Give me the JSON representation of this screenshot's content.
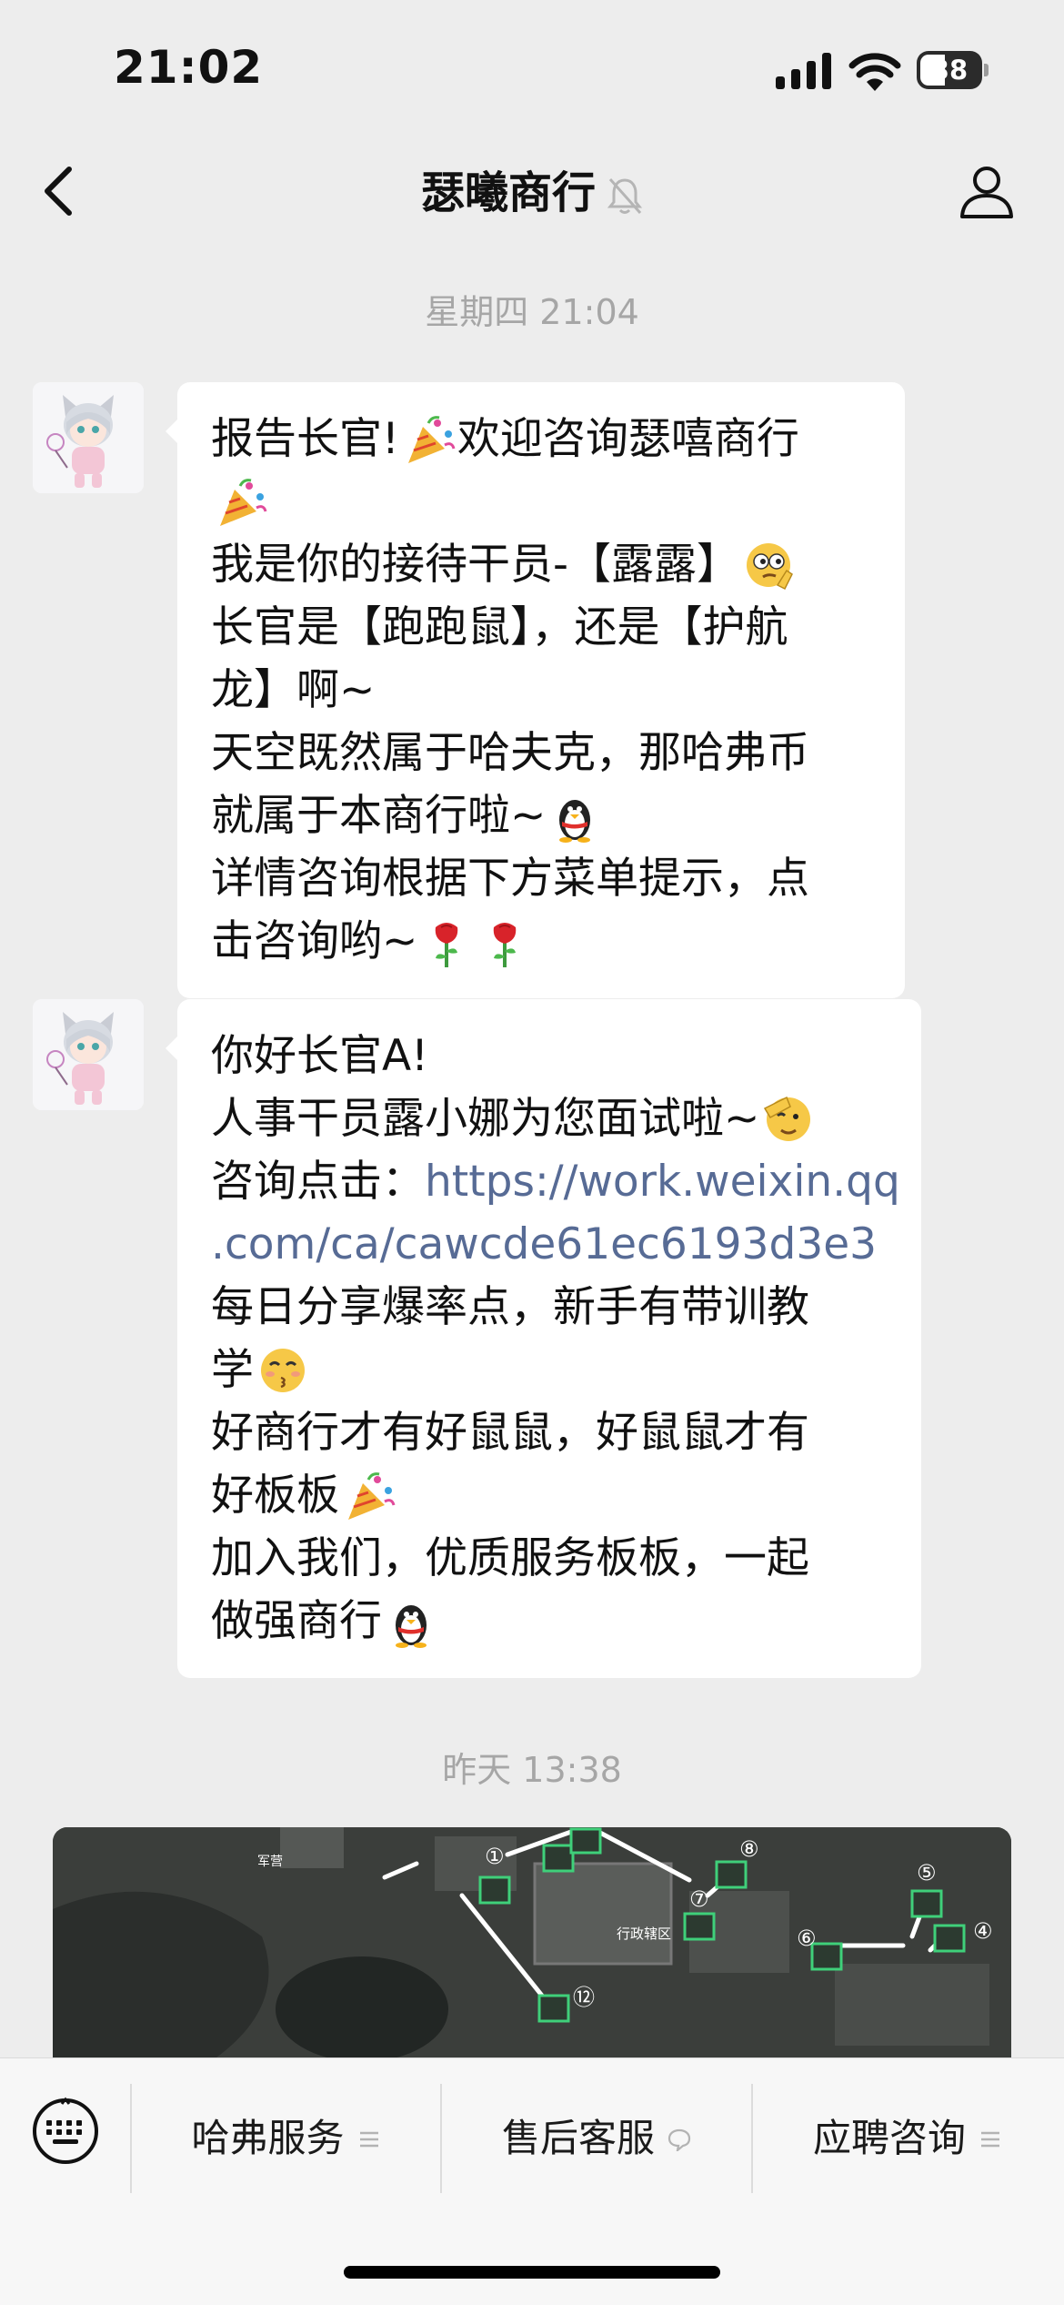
{
  "status_bar": {
    "time": "21:02",
    "battery_level": "38"
  },
  "header": {
    "title": "瑟曦商行"
  },
  "messages": [
    {
      "timestamp": "星期四 21:04",
      "lines": [
        {
          "parts": [
            {
              "text": "报告长官!"
            },
            {
              "icon": "party-popper-emoji"
            },
            {
              "text": "欢迎咨询瑟嘻商行"
            }
          ]
        },
        {
          "parts": [
            {
              "icon": "party-popper-emoji"
            }
          ]
        },
        {
          "parts": [
            {
              "text": "我是你的接待干员-【露露】"
            },
            {
              "icon": "thinking-face-emoji"
            }
          ]
        },
        {
          "parts": [
            {
              "text": "长官是【跑跑鼠】，还是【护航"
            }
          ]
        },
        {
          "parts": [
            {
              "text": "龙】啊~"
            }
          ]
        },
        {
          "parts": [
            {
              "text": "天空既然属于哈夫克，那哈弗币"
            }
          ]
        },
        {
          "parts": [
            {
              "text": "就属于本商行啦~"
            },
            {
              "icon": "qq-penguin-emoji"
            }
          ]
        },
        {
          "parts": [
            {
              "text": "详情咨询根据下方菜单提示，点"
            }
          ]
        },
        {
          "parts": [
            {
              "text": "击咨询哟~"
            },
            {
              "icon": "rose-emoji"
            },
            {
              "icon": "rose-emoji"
            }
          ]
        }
      ]
    },
    {
      "lines": [
        {
          "parts": [
            {
              "text": "你好长官A!"
            }
          ]
        },
        {
          "parts": [
            {
              "text": "人事干员露小娜为您面试啦~"
            },
            {
              "icon": "salute-face-emoji"
            }
          ]
        },
        {
          "parts": [
            {
              "text": "咨询点击："
            },
            {
              "link": "https://work.weixin.qq"
            }
          ]
        },
        {
          "parts": [
            {
              "link": ".com/ca/cawcde61ec6193d3e3"
            }
          ]
        },
        {
          "parts": [
            {
              "text": "每日分享爆率点，新手有带训教"
            }
          ]
        },
        {
          "parts": [
            {
              "text": "学"
            },
            {
              "icon": "kissing-face-emoji"
            }
          ]
        },
        {
          "parts": [
            {
              "text": "好商行才有好鼠鼠，好鼠鼠才有"
            }
          ]
        },
        {
          "parts": [
            {
              "text": "好板板"
            },
            {
              "icon": "party-popper-emoji"
            }
          ]
        },
        {
          "parts": [
            {
              "text": "加入我们，优质服务板板，一起"
            }
          ]
        },
        {
          "parts": [
            {
              "text": "做强商行"
            },
            {
              "icon": "qq-penguin-emoji"
            }
          ]
        }
      ]
    }
  ],
  "timestamp_2": "昨天 13:38",
  "map_labels": [
    "①",
    "⑫",
    "⑧",
    "⑦",
    "⑥",
    "⑤",
    "④",
    "行政辖区",
    "军营"
  ],
  "menu": [
    {
      "label": "哈弗服务",
      "icon": "menu-list-icon"
    },
    {
      "label": "售后客服",
      "icon": "chat-bubble-icon"
    },
    {
      "label": "应聘咨询",
      "icon": "menu-list-icon"
    }
  ],
  "colors": {
    "background": "#ededed",
    "bubble": "#ffffff",
    "link": "#576b95",
    "timestamp": "#a6a6a6"
  }
}
